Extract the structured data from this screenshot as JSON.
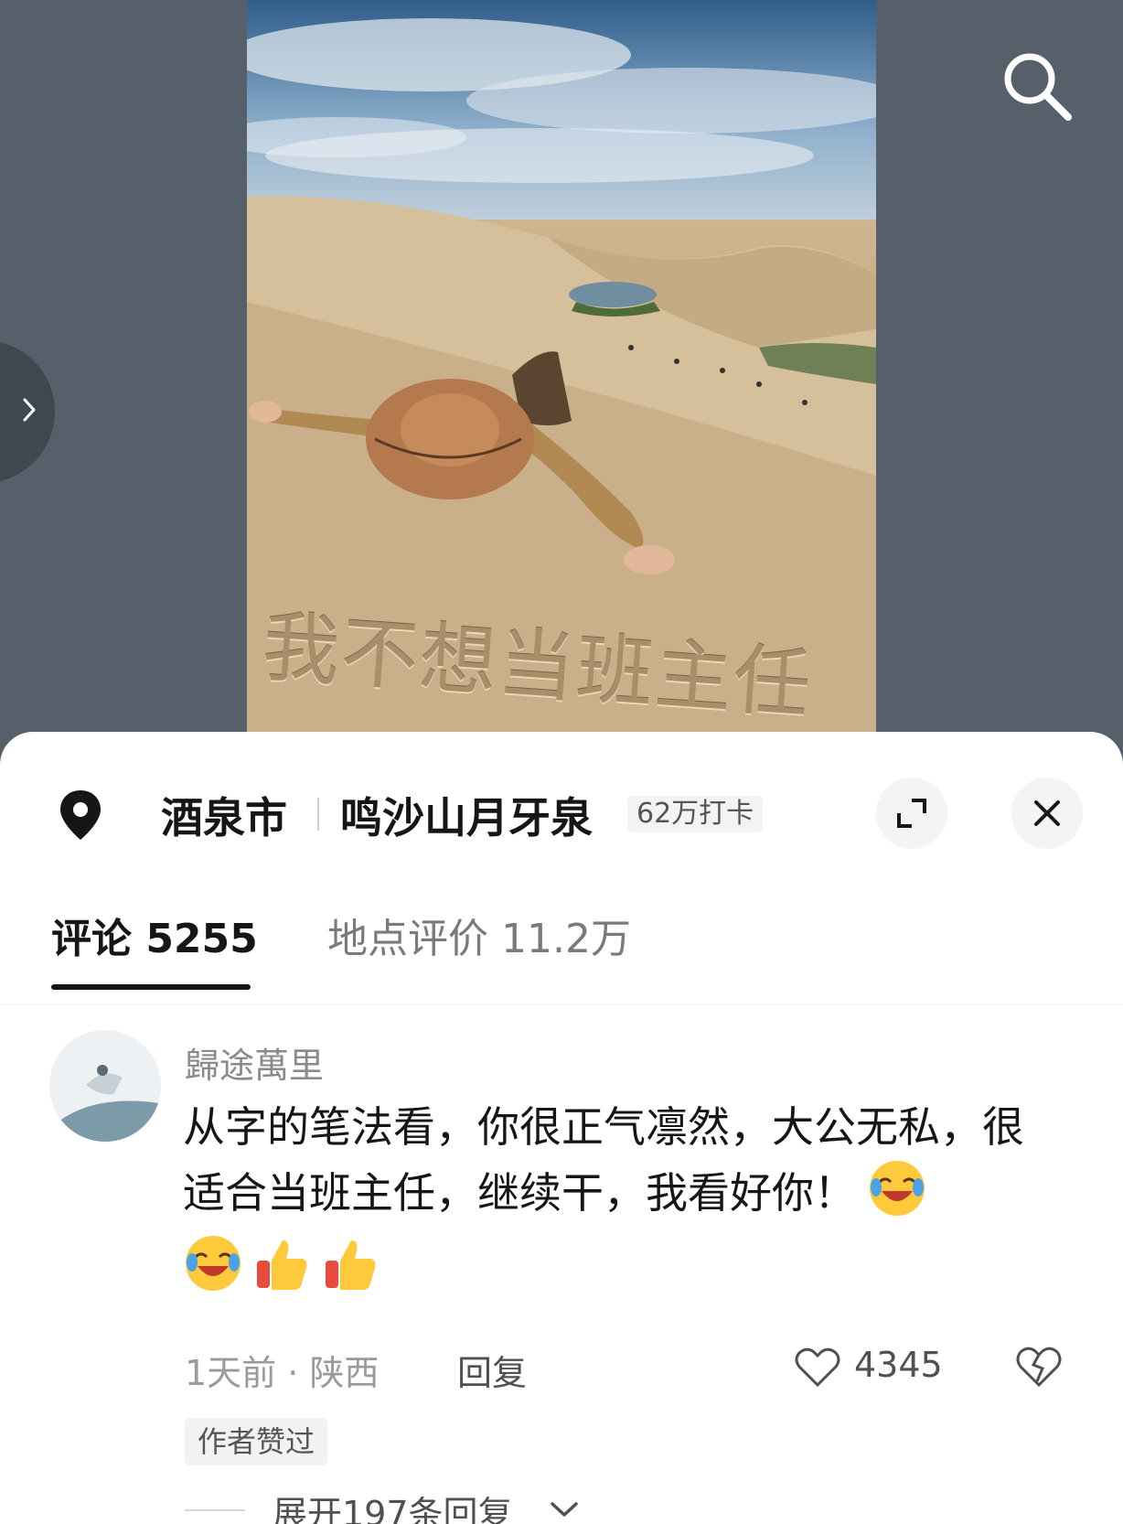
{
  "media": {
    "sand_caption": "我不想当班主任"
  },
  "location": {
    "city": "酒泉市",
    "place": "鸣沙山月牙泉",
    "checkins": "62万打卡"
  },
  "tabs": [
    {
      "label": "评论 5255",
      "active": true
    },
    {
      "label": "地点评价 11.2万",
      "active": false
    }
  ],
  "comment": {
    "username": "歸途萬里",
    "text": "从字的笔法看，你很正气凛然，大公无私，很适合当班主任，继续干，我看好你！",
    "emojis": [
      "laugh-cry-emoji",
      "laugh-cry-emoji",
      "thumbs-up-emoji",
      "thumbs-up-emoji"
    ],
    "time": "1天前",
    "separator": "·",
    "region": "陕西",
    "reply_label": "回复",
    "likes": "4345",
    "author_badge": "作者赞过",
    "expand_replies": "展开197条回复"
  },
  "colors": {
    "backdrop": "#56606a",
    "sheet": "#ffffff",
    "text_primary": "#161616",
    "text_secondary": "#9a9a9a"
  }
}
